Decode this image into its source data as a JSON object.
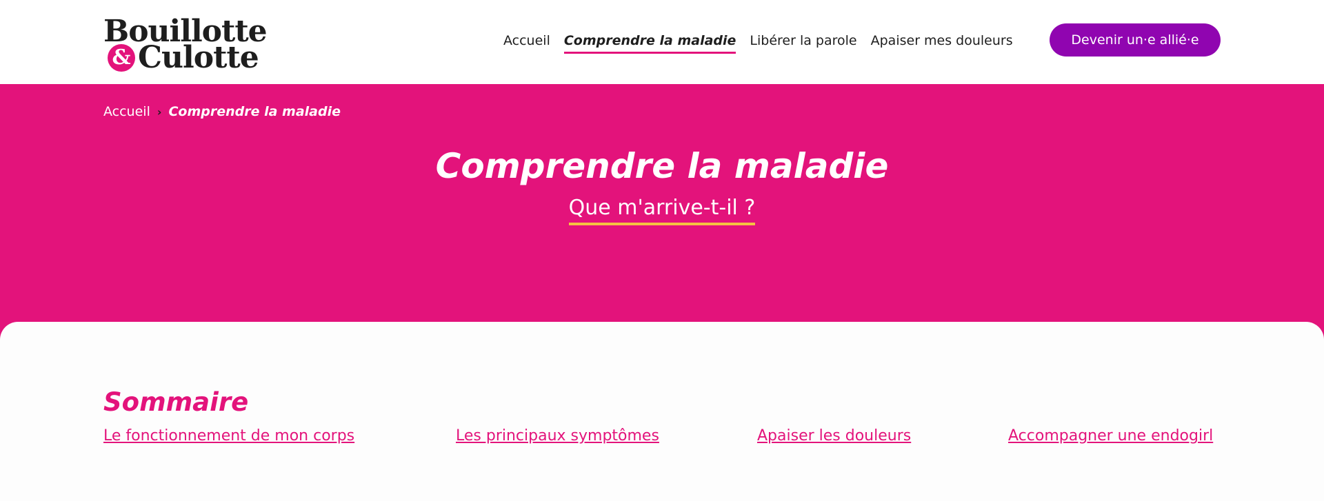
{
  "logo": {
    "line1": "Bouillotte",
    "amp": "&",
    "line2": "Culotte"
  },
  "nav": {
    "items": [
      {
        "label": "Accueil",
        "active": false
      },
      {
        "label": "Comprendre la maladie",
        "active": true
      },
      {
        "label": "Libérer la parole",
        "active": false
      },
      {
        "label": "Apaiser mes douleurs",
        "active": false
      }
    ],
    "cta_label": "Devenir un·e allié·e"
  },
  "breadcrumb": {
    "home": "Accueil",
    "separator": "›",
    "current": "Comprendre la maladie"
  },
  "hero": {
    "title": "Comprendre la maladie",
    "subtitle": "Que m'arrive-t-il ?"
  },
  "summary": {
    "title": "Sommaire",
    "links": [
      "Le fonctionnement de mon corps",
      "Les principaux symptômes",
      "Apaiser les douleurs",
      "Accompagner une endogirl"
    ]
  },
  "colors": {
    "brand_pink": "#e3137b",
    "cta_purple": "#9005b0",
    "accent_yellow": "#f5c242"
  }
}
